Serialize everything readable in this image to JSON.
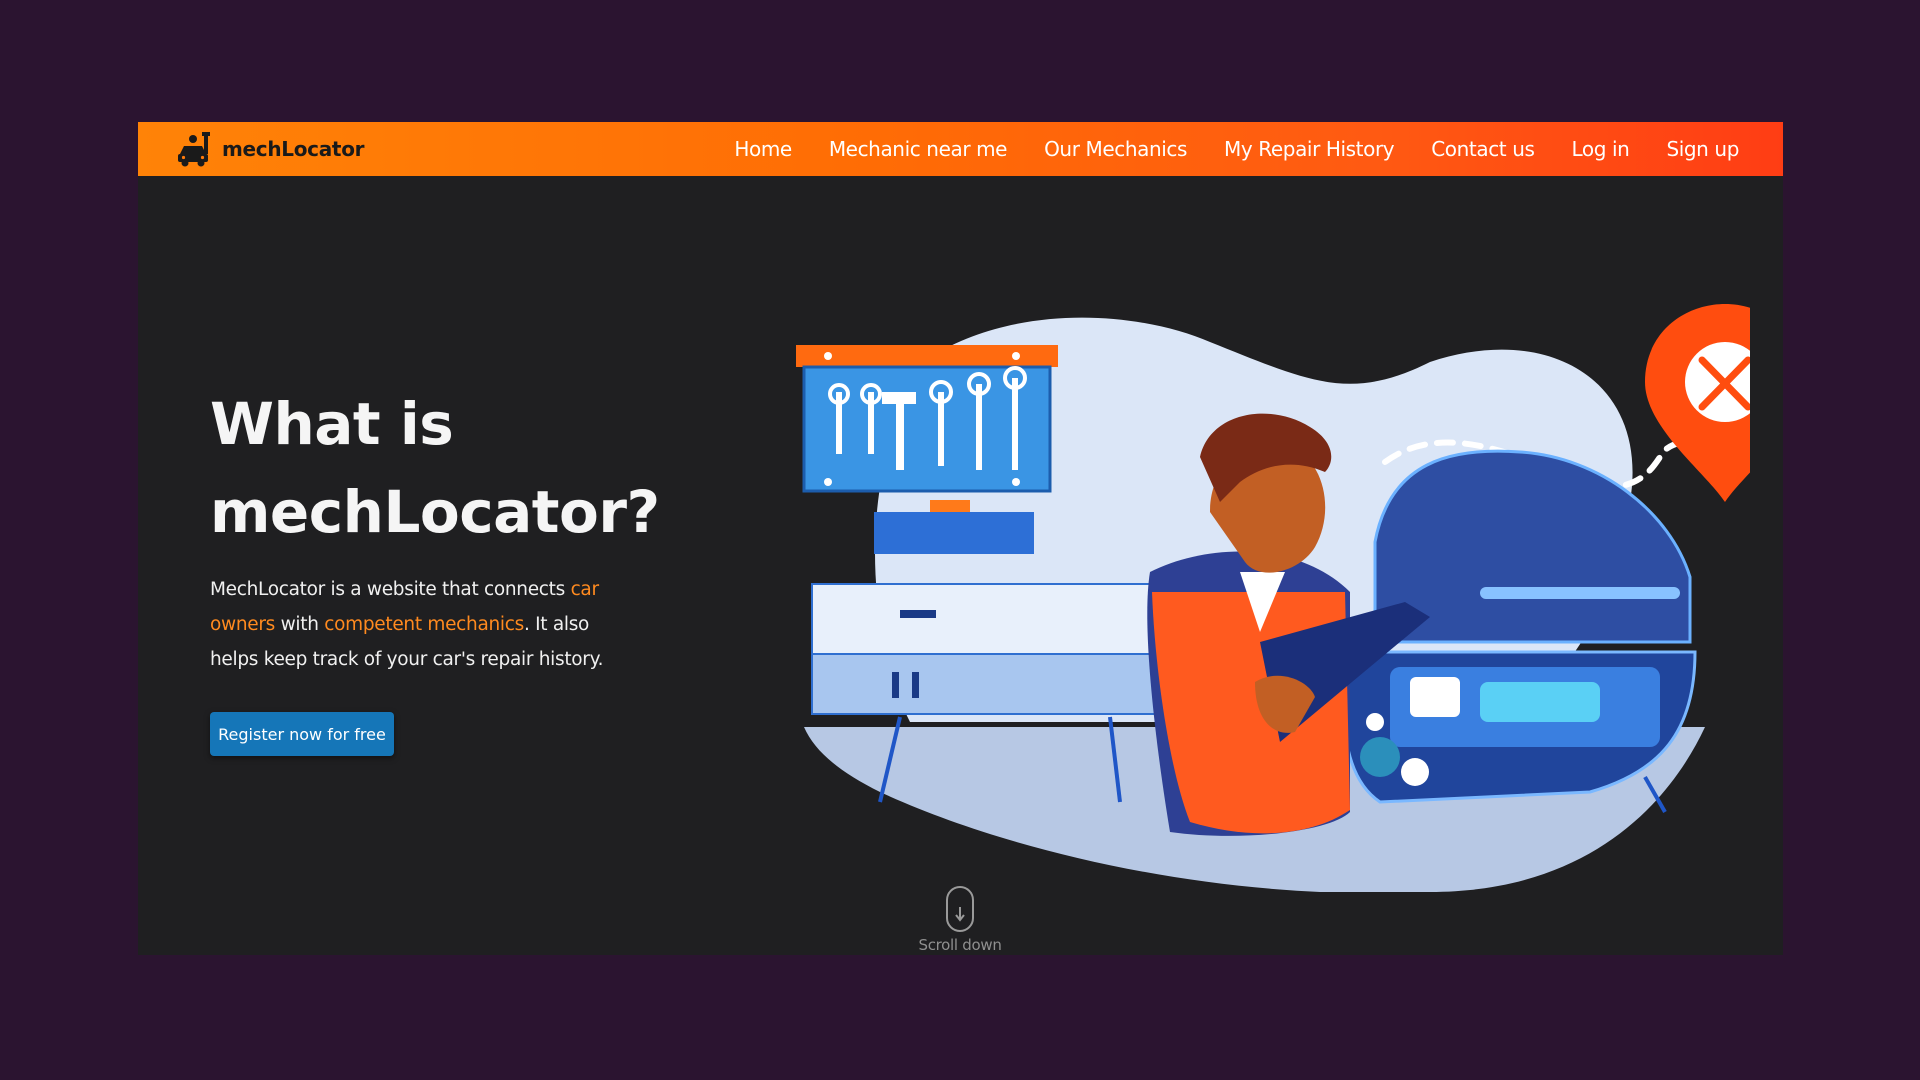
{
  "brand": {
    "name": "mechLocator",
    "logo_icon": "mechanic-car-icon"
  },
  "nav": {
    "items": [
      {
        "label": "Home"
      },
      {
        "label": "Mechanic near me"
      },
      {
        "label": "Our Mechanics"
      },
      {
        "label": "My Repair History"
      },
      {
        "label": "Contact us"
      },
      {
        "label": "Log in"
      },
      {
        "label": "Sign up"
      }
    ]
  },
  "hero": {
    "title_line1": "What is",
    "title_line2": "mechLocator?",
    "desc_part1": "MechLocator is a website that connects ",
    "desc_highlight1": "car owners",
    "desc_part2": " with ",
    "desc_highlight2": "competent mechanics",
    "desc_part3": ". It also helps keep track of your car's repair history.",
    "cta_label": "Register now for free"
  },
  "illustration": {
    "name": "mechanic-with-clipboard-illustration",
    "pin_icon": "location-pin-tools-icon"
  },
  "scroll": {
    "label": "Scroll down",
    "icon": "mouse-scroll-icon"
  },
  "colors": {
    "page_bg": "#2b1430",
    "frame_bg": "#1f1f21",
    "nav_gradient_start": "#ff8307",
    "nav_gradient_end": "#ff3d14",
    "accent": "#ff8a1f",
    "cta_bg": "#1576b8"
  }
}
